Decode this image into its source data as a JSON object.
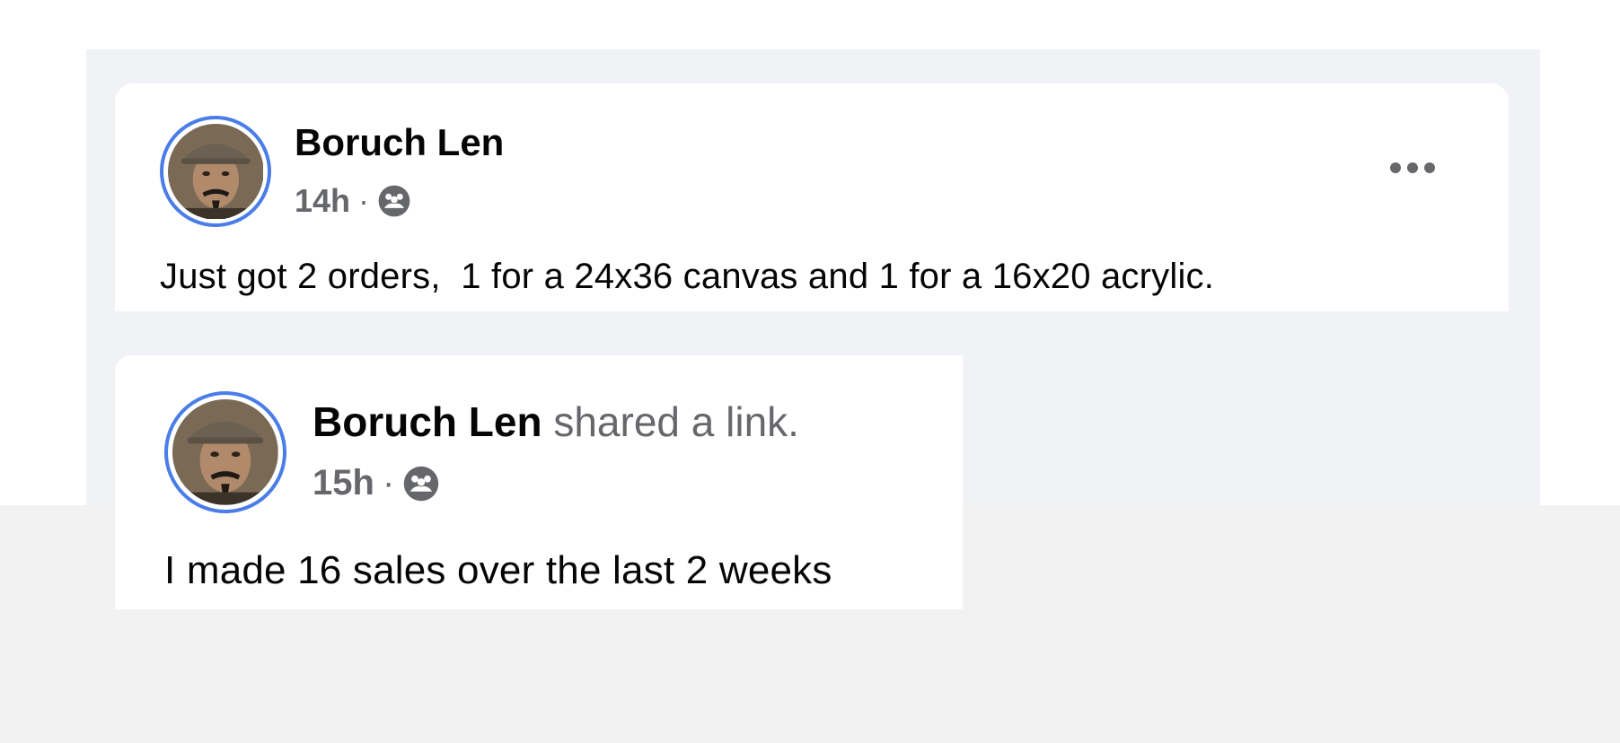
{
  "posts": [
    {
      "author": "Boruch Len",
      "action": "",
      "time": "14h",
      "separator": "·",
      "audience_icon": "group-icon",
      "text": "Just got 2 orders,  1 for a 24x36 canvas and 1 for a 16x20 acrylic.",
      "menu_icon": "more-options-icon"
    },
    {
      "author": "Boruch Len",
      "action": "shared a link.",
      "time": "15h",
      "separator": "·",
      "audience_icon": "group-icon",
      "text": "I made 16 sales over the last 2 weeks"
    }
  ],
  "colors": {
    "feed_background": "#f0f2f5",
    "card_background": "#ffffff",
    "avatar_ring": "#4a7de8",
    "primary_text": "#050505",
    "secondary_text": "#65676b"
  }
}
